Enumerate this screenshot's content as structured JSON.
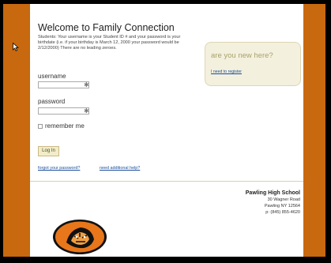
{
  "header": {
    "title": "Welcome to Family Connection",
    "intro": "Students: Your username is your Student ID # and your password is your birthdate (i.e. if your birthday is March 12, 2000 your password would be 2/12/2000) There are no leading zeroes."
  },
  "login": {
    "username_label": "username",
    "username_value": "",
    "password_label": "password",
    "password_value": "",
    "required_mark": "✱",
    "remember_label": "remember me",
    "remember_checked": false,
    "login_button": "Log In",
    "forgot_link": "forgot your password?",
    "help_link": "need additional help?"
  },
  "new_user": {
    "heading": "are you new here?",
    "register_link": "I need to register"
  },
  "school": {
    "name": "Pawling High School",
    "address1": "30 Wagner Road",
    "address2": "Pawling NY 12564",
    "phone": "p: (845) 855-4620"
  },
  "colors": {
    "side_bars": "#c8680f",
    "link": "#1a4e9a",
    "new_box_bg": "#f3f0de"
  },
  "icons": {
    "cursor": "mouse-pointer-icon",
    "logo": "tiger-logo-icon"
  }
}
